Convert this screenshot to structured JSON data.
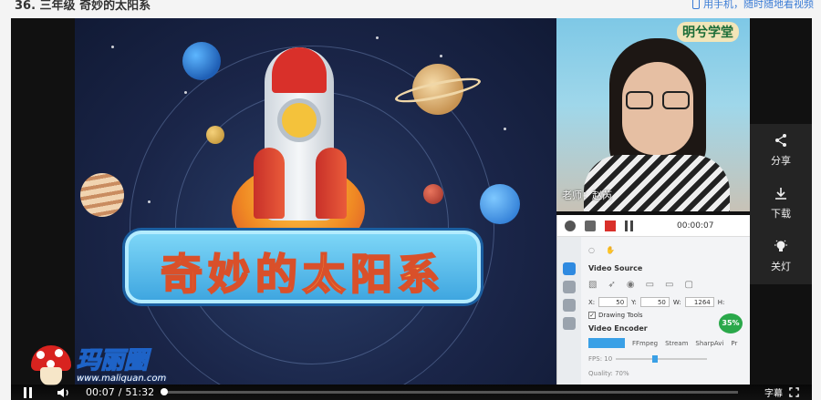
{
  "header": {
    "title": "36. 三年级 奇妙的太阳系",
    "mobile_link": "用手机，随时随地看视频"
  },
  "slide": {
    "banner_text": "奇妙的太阳系"
  },
  "webcam": {
    "brand": "明兮学堂",
    "caption": "老师：赵芮"
  },
  "recorder": {
    "time": "00:00:07",
    "video_source_label": "Video Source",
    "x_label": "X:",
    "x_value": "50",
    "y_label": "Y:",
    "y_value": "50",
    "w_label": "W:",
    "w_value": "1264",
    "h_label": "H:",
    "drawing_tools_label": "Drawing Tools",
    "video_encoder_label": "Video Encoder",
    "encoders": [
      "FFmpeg",
      "Stream",
      "SharpAvi",
      "Pr"
    ],
    "fps_label": "FPS: 10",
    "quality_label": "Quality: 70%",
    "progress_badge": "35%",
    "progress_value": 0.35
  },
  "side_actions": [
    {
      "icon": "share-icon",
      "label": "分享"
    },
    {
      "icon": "download-icon",
      "label": "下载"
    },
    {
      "icon": "light-bulb-icon",
      "label": "关灯"
    }
  ],
  "watermark": {
    "cn": "玛丽圈",
    "url": "www.maliquan.com"
  },
  "player": {
    "current_time": "00:07",
    "separator": "/",
    "duration": "51:32",
    "progress": 0.002,
    "subtitle_label": "字幕"
  }
}
